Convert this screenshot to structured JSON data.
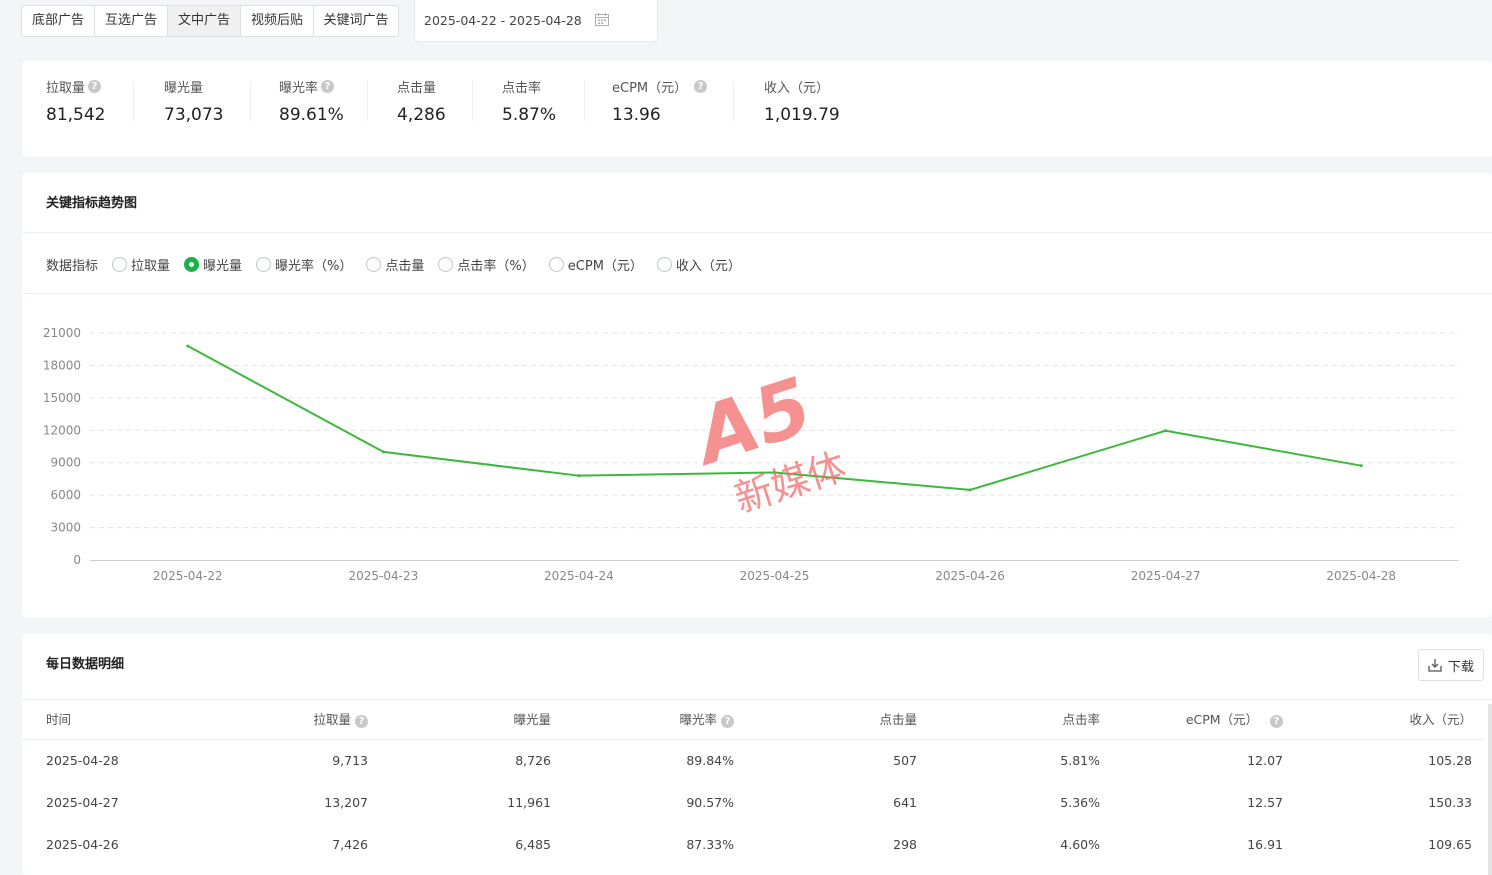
{
  "tabs": [
    {
      "label": "底部广告",
      "active": false
    },
    {
      "label": "互选广告",
      "active": false
    },
    {
      "label": "文中广告",
      "active": true
    },
    {
      "label": "视频后贴",
      "active": false
    },
    {
      "label": "关键词广告",
      "active": false
    }
  ],
  "date_range": "2025-04-22 - 2025-04-28",
  "stats": [
    {
      "label": "拉取量",
      "value": "81,542",
      "help": true
    },
    {
      "label": "曝光量",
      "value": "73,073",
      "help": false
    },
    {
      "label": "曝光率",
      "value": "89.61%",
      "help": true
    },
    {
      "label": "点击量",
      "value": "4,286",
      "help": false
    },
    {
      "label": "点击率",
      "value": "5.87%",
      "help": false
    },
    {
      "label": "eCPM（元）",
      "value": "13.96",
      "help": true
    },
    {
      "label": "收入（元）",
      "value": "1,019.79",
      "help": false
    }
  ],
  "trend": {
    "title": "关键指标趋势图",
    "metric_label": "数据指标",
    "options": [
      {
        "label": "拉取量",
        "checked": false
      },
      {
        "label": "曝光量",
        "checked": true
      },
      {
        "label": "曝光率（%）",
        "checked": false
      },
      {
        "label": "点击量",
        "checked": false
      },
      {
        "label": "点击率（%）",
        "checked": false
      },
      {
        "label": "eCPM（元）",
        "checked": false
      },
      {
        "label": "收入（元）",
        "checked": false
      }
    ]
  },
  "watermark": {
    "logo": "A5",
    "text": "新媒体"
  },
  "chart_data": {
    "type": "line",
    "categories": [
      "2025-04-22",
      "2025-04-23",
      "2025-04-24",
      "2025-04-25",
      "2025-04-26",
      "2025-04-27",
      "2025-04-28"
    ],
    "series": [
      {
        "values": [
          19800,
          10000,
          7800,
          8100,
          6485,
          11961,
          8726
        ],
        "color": "#3cb83c"
      }
    ],
    "yticks": [
      0,
      3000,
      6000,
      9000,
      12000,
      15000,
      18000,
      21000
    ],
    "ylim": [
      0,
      21000
    ],
    "grid": true,
    "legend": "none"
  },
  "detail": {
    "title": "每日数据明细",
    "download_label": "下载",
    "columns": [
      {
        "label": "时间",
        "help": false
      },
      {
        "label": "拉取量",
        "help": true
      },
      {
        "label": "曝光量",
        "help": false
      },
      {
        "label": "曝光率",
        "help": true
      },
      {
        "label": "点击量",
        "help": false
      },
      {
        "label": "点击率",
        "help": false
      },
      {
        "label": "eCPM（元）",
        "help": true
      },
      {
        "label": "收入（元）",
        "help": false
      }
    ],
    "rows": [
      [
        "2025-04-28",
        "9,713",
        "8,726",
        "89.84%",
        "507",
        "5.81%",
        "12.07",
        "105.28"
      ],
      [
        "2025-04-27",
        "13,207",
        "11,961",
        "90.57%",
        "641",
        "5.36%",
        "12.57",
        "150.33"
      ],
      [
        "2025-04-26",
        "7,426",
        "6,485",
        "87.33%",
        "298",
        "4.60%",
        "16.91",
        "109.65"
      ]
    ]
  }
}
